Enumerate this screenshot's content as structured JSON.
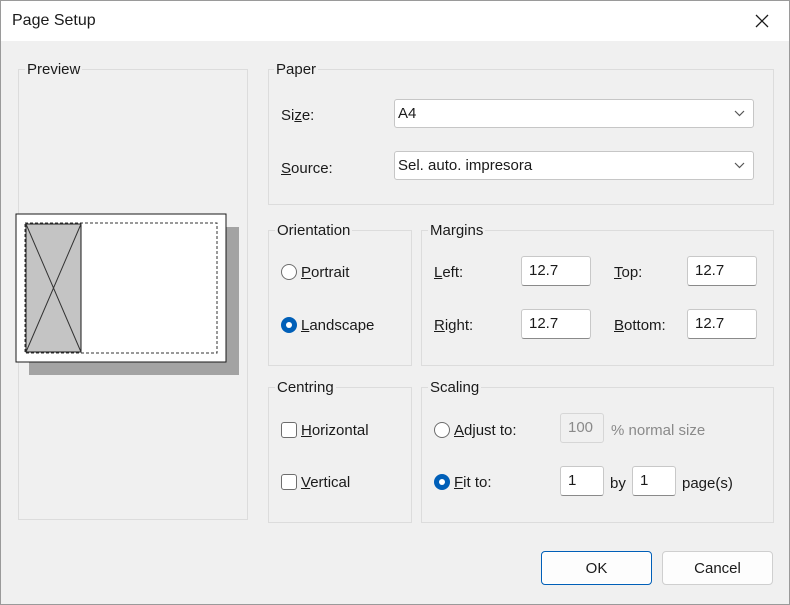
{
  "window": {
    "title": "Page Setup"
  },
  "preview": {
    "label": "Preview"
  },
  "paper": {
    "label": "Paper",
    "size_label": "Size:",
    "size_value": "A4",
    "source_label": "Source:",
    "source_value": "Sel. auto. impresora"
  },
  "orientation": {
    "label": "Orientation",
    "portrait": "Portrait",
    "landscape": "Landscape",
    "selected": "landscape"
  },
  "margins": {
    "label": "Margins",
    "left_label": "Left:",
    "left_value": "12.7",
    "right_label": "Right:",
    "right_value": "12.7",
    "top_label": "Top:",
    "top_value": "12.7",
    "bottom_label": "Bottom:",
    "bottom_value": "12.7"
  },
  "centring": {
    "label": "Centring",
    "horizontal": "Horizontal",
    "vertical": "Vertical"
  },
  "scaling": {
    "label": "Scaling",
    "adjust_label": "Adjust to:",
    "adjust_value": "100",
    "adjust_suffix": "% normal size",
    "fit_label": "Fit to:",
    "fit_wide": "1",
    "by_label": "by",
    "fit_tall": "1",
    "pages_label": "page(s)",
    "selected": "fit"
  },
  "buttons": {
    "ok": "OK",
    "cancel": "Cancel"
  },
  "colors": {
    "accent": "#005fb8",
    "preview_shadow": "#a3a3a3",
    "preview_fill": "#c4c4c4"
  }
}
